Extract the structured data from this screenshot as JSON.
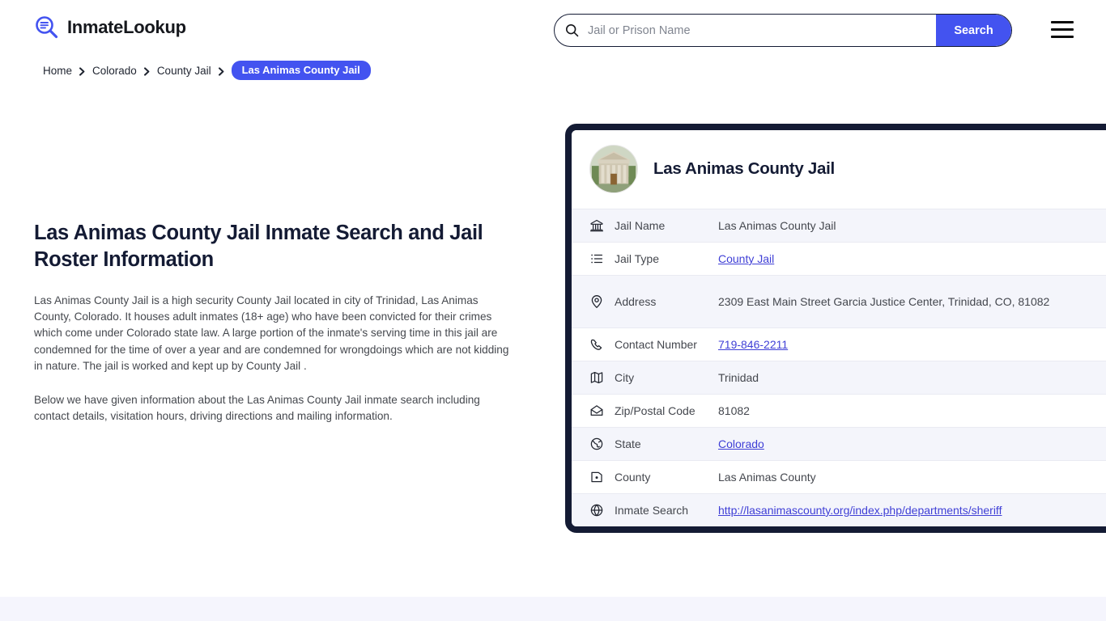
{
  "brand": {
    "name": "InmateLookup",
    "logo_icon": "magnifier-list-icon",
    "accent_color": "#4353f0",
    "dark_color": "#141b34"
  },
  "search": {
    "placeholder": "Jail or Prison Name",
    "value": "",
    "button_label": "Search",
    "icon": "search-icon"
  },
  "menu": {
    "icon": "hamburger-menu-icon"
  },
  "breadcrumb": {
    "items": [
      {
        "label": "Home"
      },
      {
        "label": "Colorado"
      },
      {
        "label": "County Jail"
      }
    ],
    "current": "Las Animas County Jail",
    "separator_icon": "chevron-right-icon"
  },
  "article": {
    "title": "Las Animas County Jail Inmate Search and Jail Roster Information",
    "paragraph_1": "Las Animas County Jail is a high security County Jail located in city of Trinidad, Las Animas County, Colorado. It houses adult inmates (18+ age) who have been convicted for their crimes which come under Colorado state law. A large portion of the inmate's serving time in this jail are condemned for the time of over a year and are condemned for wrongdoings which are not kidding in nature. The jail is worked and kept up by County Jail .",
    "paragraph_2": "Below we have given information about the Las Animas County Jail inmate search including contact details, visitation hours, driving directions and mailing information."
  },
  "info_card": {
    "title": "Las Animas County Jail",
    "avatar_icon": "courthouse-photo",
    "rows": [
      {
        "icon": "bank-icon",
        "label": "Jail Name",
        "value": "Las Animas County Jail",
        "is_link": false
      },
      {
        "icon": "list-icon",
        "label": "Jail Type",
        "value": "County Jail",
        "is_link": true
      },
      {
        "icon": "map-pin-icon",
        "label": "Address",
        "value": "2309 East Main Street Garcia Justice Center, Trinidad, CO, 81082",
        "is_link": false
      },
      {
        "icon": "phone-icon",
        "label": "Contact Number",
        "value": "719-846-2211",
        "is_link": true
      },
      {
        "icon": "map-icon",
        "label": "City",
        "value": "Trinidad",
        "is_link": false
      },
      {
        "icon": "envelope-icon",
        "label": "Zip/Postal Code",
        "value": "81082",
        "is_link": false
      },
      {
        "icon": "globe-americas-icon",
        "label": "State",
        "value": "Colorado",
        "is_link": true
      },
      {
        "icon": "county-icon",
        "label": "County",
        "value": "Las Animas County",
        "is_link": false
      },
      {
        "icon": "globe-icon",
        "label": "Inmate Search",
        "value": "http://lasanimascounty.org/index.php/departments/sheriff",
        "is_link": true
      }
    ]
  }
}
